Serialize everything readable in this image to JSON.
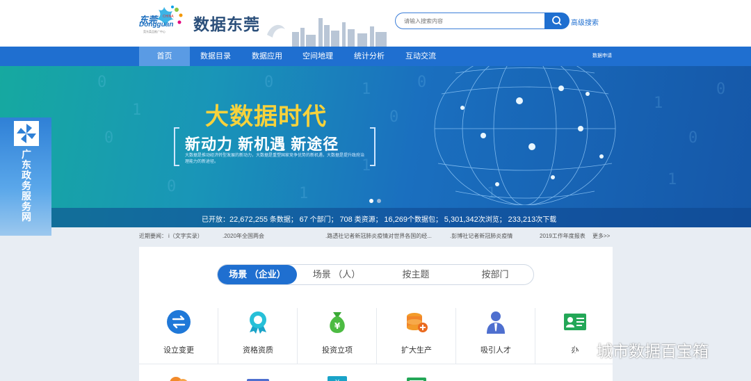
{
  "header": {
    "logo_cn": "东莞",
    "logo_en": "Dongguan",
    "logo_china": "CHINA",
    "logo_sub": "莞东菜品推广中心",
    "site_title": "数据东莞",
    "search_placeholder": "请输入搜索内容",
    "advanced_search": "高级搜索"
  },
  "nav": {
    "items": [
      "首页",
      "数据目录",
      "数据应用",
      "空间地理",
      "统计分析",
      "互动交流"
    ],
    "active_index": 0,
    "right_label": "数据申请"
  },
  "banner": {
    "title": "大数据时代",
    "subtitle": "新动力  新机遇  新途径",
    "description": "大数据是推动经济转型发展的新动力，大数据是重塑国家竞争优势的新机遇，大数据是提升政府治理能力的新途径。",
    "slide_count": 2,
    "active_slide": 0
  },
  "stats": {
    "prefix": "已开放：",
    "datasets": "22,672,255",
    "datasets_unit": "条数据；",
    "departments": "67",
    "departments_unit": "个部门；",
    "resources": "708",
    "resources_unit": "类资源；",
    "packages": "16,269",
    "packages_unit": "个数据包；",
    "views": "5,301,342",
    "views_unit": "次浏览；",
    "downloads": "233,213",
    "downloads_unit": "次下载"
  },
  "side_widget": {
    "label": "广东政务服务网"
  },
  "ticker": {
    "label": "近期要闻：",
    "items": [
      "i（文字实录）",
      ".2020年全国两会",
      ".路透社记者新冠肺炎疫情对世界各国的经...",
      ".彭博社记者新冠肺炎疫情",
      "2019工作年度报表"
    ],
    "more": "更多>>"
  },
  "tabs": {
    "items": [
      "场景 （企业）",
      "场景 （人）",
      "按主题",
      "按部门"
    ],
    "active_index": 0
  },
  "categories": [
    {
      "label": "设立变更",
      "icon": "exchange-icon"
    },
    {
      "label": "资格资质",
      "icon": "award-ribbon-icon"
    },
    {
      "label": "投资立项",
      "icon": "money-bag-icon"
    },
    {
      "label": "扩大生产",
      "icon": "coins-add-icon"
    },
    {
      "label": "吸引人才",
      "icon": "person-icon"
    },
    {
      "label": "办",
      "icon": "id-card-icon"
    }
  ],
  "watermark": {
    "text": "城市数据百宝箱"
  },
  "colors": {
    "primary": "#1f6fd0",
    "banner_title": "#f7d23c",
    "nav_active": "#5a9be4"
  }
}
